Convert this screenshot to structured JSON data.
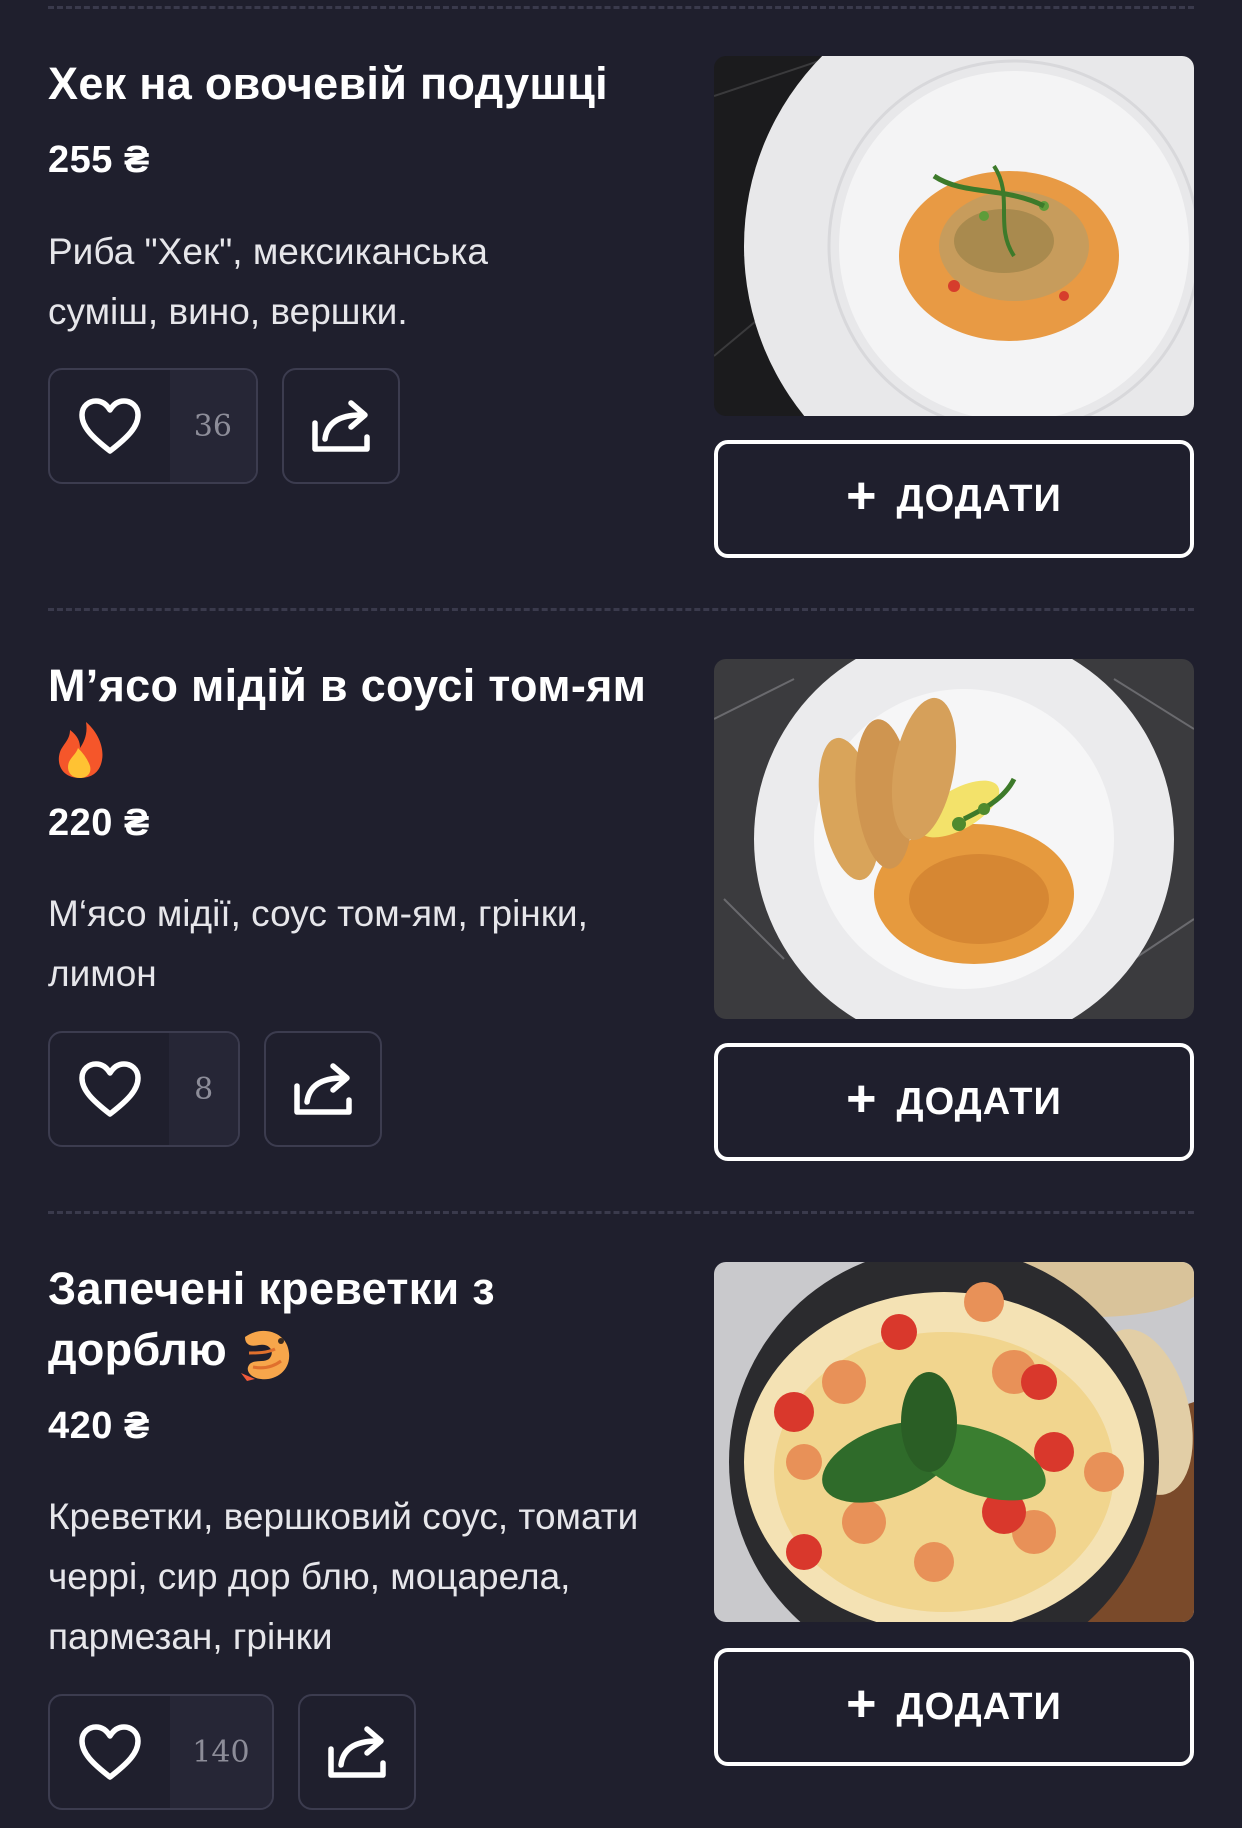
{
  "items": [
    {
      "title": "Хек на овочевій подушці",
      "price": "255 ₴",
      "description": "Риба \"Хек\", мексиканська суміш, вино, вершки.",
      "likes": "36",
      "add_label": "ДОДАТИ",
      "plus": "+",
      "photo": "hake-dish-photo"
    },
    {
      "title": "М’ясо мідій в соусі том-ям",
      "title_emoji": "fire-emoji",
      "price": "220 ₴",
      "description": "М‘ясо мідії, соус том-ям, грінки, лимон",
      "likes": "8",
      "add_label": "ДОДАТИ",
      "plus": "+",
      "photo": "mussels-tom-yum-photo"
    },
    {
      "title": "Запечені креветки з дорблю",
      "title_emoji": "shrimp-emoji",
      "price": "420 ₴",
      "description": "Креветки, вершковий соус, томати черрі, сир дор блю, моцарела, пармезан, грінки",
      "likes": "140",
      "add_label": "ДОДАТИ",
      "plus": "+",
      "photo": "baked-shrimp-photo"
    }
  ],
  "icons": {
    "like": "heart-icon",
    "share": "share-icon"
  },
  "colors": {
    "background": "#1f1f2d",
    "border": "#3c3c4f",
    "count_text": "#8d8d99",
    "text": "#ffffff"
  }
}
